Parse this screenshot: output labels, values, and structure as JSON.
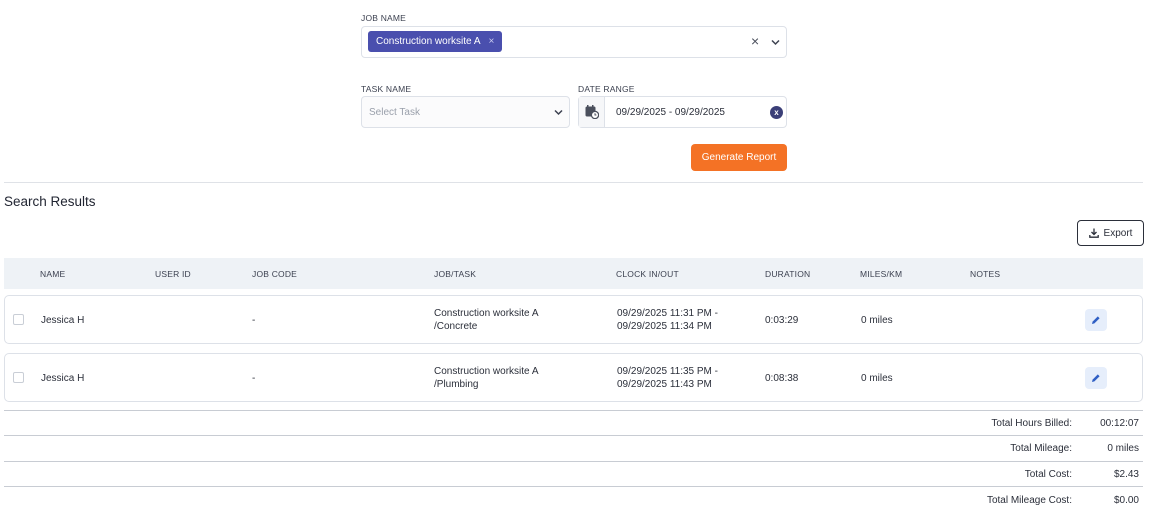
{
  "filters": {
    "job_name_label": "JOB NAME",
    "job_chip": "Construction worksite A",
    "chip_remove": "×",
    "clear": "×",
    "task_label": "TASK NAME",
    "task_placeholder": "Select Task",
    "date_label": "DATE RANGE",
    "date_value": "09/29/2025 - 09/29/2025",
    "date_clear": "x",
    "generate_button": "Generate Report"
  },
  "results": {
    "title": "Search Results",
    "export_label": "Export",
    "columns": [
      "NAME",
      "USER ID",
      "JOB CODE",
      "JOB/TASK",
      "CLOCK IN/OUT",
      "DURATION",
      "MILES/KM",
      "NOTES"
    ],
    "rows": [
      {
        "name": "Jessica H",
        "user_id": "",
        "job_code": "-",
        "job_line1": "Construction worksite A",
        "job_line2": "/Concrete",
        "clock_line1": "09/29/2025 11:31 PM -",
        "clock_line2": "09/29/2025 11:34 PM",
        "duration": "0:03:29",
        "miles": "0 miles",
        "notes": ""
      },
      {
        "name": "Jessica H",
        "user_id": "",
        "job_code": "-",
        "job_line1": "Construction worksite A",
        "job_line2": "/Plumbing",
        "clock_line1": "09/29/2025 11:35 PM -",
        "clock_line2": "09/29/2025 11:43 PM",
        "duration": "0:08:38",
        "miles": "0 miles",
        "notes": ""
      }
    ]
  },
  "totals": [
    {
      "label": "Total Hours Billed:",
      "value": "00:12:07"
    },
    {
      "label": "Total Mileage:",
      "value": "0 miles"
    },
    {
      "label": "Total Cost:",
      "value": "$2.43"
    },
    {
      "label": "Total Mileage Cost:",
      "value": "$0.00"
    }
  ],
  "colors": {
    "accent_orange": "#f47225",
    "chip_indigo": "#4a4fae",
    "header_bg": "#eef2f6"
  },
  "icons": [
    "chevron-down-icon",
    "calendar-icon",
    "download-icon",
    "pencil-icon",
    "close-icon"
  ]
}
